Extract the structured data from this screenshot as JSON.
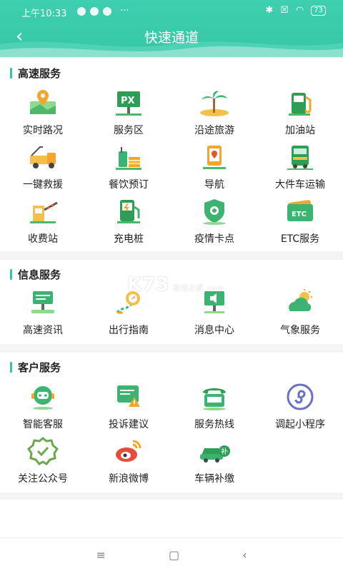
{
  "status": {
    "time": "上午10:33",
    "dots": "···",
    "battery": "73"
  },
  "nav": {
    "title": "快速通道"
  },
  "sections": [
    {
      "title": "高速服务",
      "items": [
        {
          "label": "实时路况",
          "icon": "map-pin-icon"
        },
        {
          "label": "服务区",
          "icon": "service-area-sign-icon"
        },
        {
          "label": "沿途旅游",
          "icon": "palm-island-icon"
        },
        {
          "label": "加油站",
          "icon": "fuel-pump-icon"
        },
        {
          "label": "一键救援",
          "icon": "tow-truck-icon"
        },
        {
          "label": "餐饮预订",
          "icon": "food-drink-icon"
        },
        {
          "label": "导航",
          "icon": "navigation-map-icon"
        },
        {
          "label": "大件车运输",
          "icon": "heavy-truck-icon"
        },
        {
          "label": "收费站",
          "icon": "toll-gate-icon"
        },
        {
          "label": "充电桩",
          "icon": "charging-station-icon"
        },
        {
          "label": "疫情卡点",
          "icon": "virus-shield-icon"
        },
        {
          "label": "ETC服务",
          "icon": "etc-card-icon"
        }
      ]
    },
    {
      "title": "信息服务",
      "items": [
        {
          "label": "高速资讯",
          "icon": "info-screen-icon"
        },
        {
          "label": "出行指南",
          "icon": "compass-route-icon"
        },
        {
          "label": "消息中心",
          "icon": "speaker-board-icon"
        },
        {
          "label": "气象服务",
          "icon": "weather-cloud-sun-icon"
        }
      ]
    },
    {
      "title": "客户服务",
      "items": [
        {
          "label": "智能客服",
          "icon": "robot-headset-icon"
        },
        {
          "label": "投诉建议",
          "icon": "complaint-warning-icon"
        },
        {
          "label": "服务热线",
          "icon": "hotline-phone-icon"
        },
        {
          "label": "调起小程序",
          "icon": "mini-program-icon"
        },
        {
          "label": "关注公众号",
          "icon": "verified-badge-icon"
        },
        {
          "label": "新浪微博",
          "icon": "weibo-icon"
        },
        {
          "label": "车辆补缴",
          "icon": "car-payment-icon"
        }
      ]
    }
  ],
  "watermark": {
    "main": "K73",
    "sub1": "游戏之家",
    "sub2": ".com"
  },
  "bottom_nav": {
    "menu": "≡",
    "home": "▢",
    "back": "‹"
  },
  "colors": {
    "accent": "#35c7a5",
    "orange": "#f4a62a",
    "green": "#3cb371"
  }
}
